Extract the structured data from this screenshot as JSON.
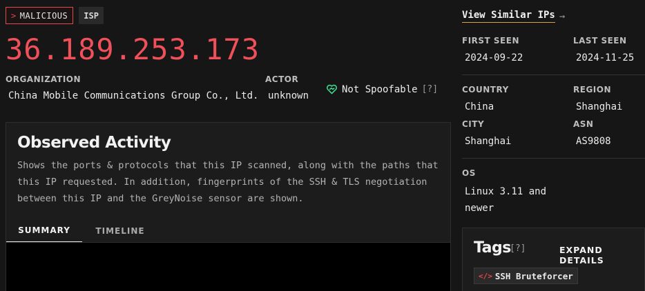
{
  "badges": {
    "classification": "MALICIOUS",
    "type": "ISP"
  },
  "ip": "36.189.253.173",
  "organization": {
    "label": "ORGANIZATION",
    "value": "China Mobile Communications Group Co., Ltd."
  },
  "actor": {
    "label": "ACTOR",
    "value": "unknown"
  },
  "spoof": {
    "label": "Not Spoofable",
    "help": "[?]"
  },
  "observed": {
    "title": "Observed Activity",
    "description": "Shows the ports & protocols that this IP scanned, along with the paths that this IP requested. In addition, fingerprints of the SSH & TLS negotiation between this IP and the GreyNoise sensor are shown.",
    "tabs": [
      {
        "label": "SUMMARY",
        "active": true
      },
      {
        "label": "TIMELINE",
        "active": false
      }
    ]
  },
  "similar": {
    "label": "View Similar IPs",
    "arrow": "→"
  },
  "details": {
    "first_seen": {
      "label": "FIRST SEEN",
      "value": "2024-09-22"
    },
    "last_seen": {
      "label": "LAST SEEN",
      "value": "2024-11-25"
    },
    "country": {
      "label": "COUNTRY",
      "value": "China"
    },
    "region": {
      "label": "REGION",
      "value": "Shanghai"
    },
    "city": {
      "label": "CITY",
      "value": "Shanghai"
    },
    "asn": {
      "label": "ASN",
      "value": "AS9808"
    },
    "os": {
      "label": "OS",
      "value": "Linux 3.11 and newer"
    }
  },
  "tags": {
    "title": "Tags",
    "help": "[?]",
    "expand_label": "EXPAND DETAILS",
    "items": [
      {
        "label": "SSH Bruteforcer",
        "icon": "code-icon"
      }
    ]
  },
  "colors": {
    "malicious": "#e5484d",
    "ip": "#f0505a",
    "spoof_icon": "#3ddc97",
    "link_underline": "#d9a441"
  }
}
